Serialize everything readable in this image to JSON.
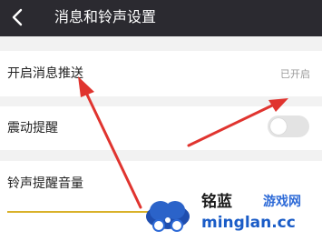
{
  "header": {
    "back_icon": "chevron-left-icon",
    "title": "消息和铃声设置"
  },
  "rows": [
    {
      "label": "开启消息推送",
      "value": "已开启"
    },
    {
      "label": "震动提醒",
      "toggle_on": false
    },
    {
      "label": "铃声提醒音量"
    }
  ],
  "colors": {
    "header_bg": "#2b2a30",
    "page_bg": "#f2f2f2",
    "arrow": "#e0342f",
    "slider": "#d9b12a",
    "watermark_blue": "#2d6ad7"
  },
  "watermark": {
    "brand": "铭蓝",
    "subtitle": "游戏网",
    "domain": "minglan.cc"
  }
}
